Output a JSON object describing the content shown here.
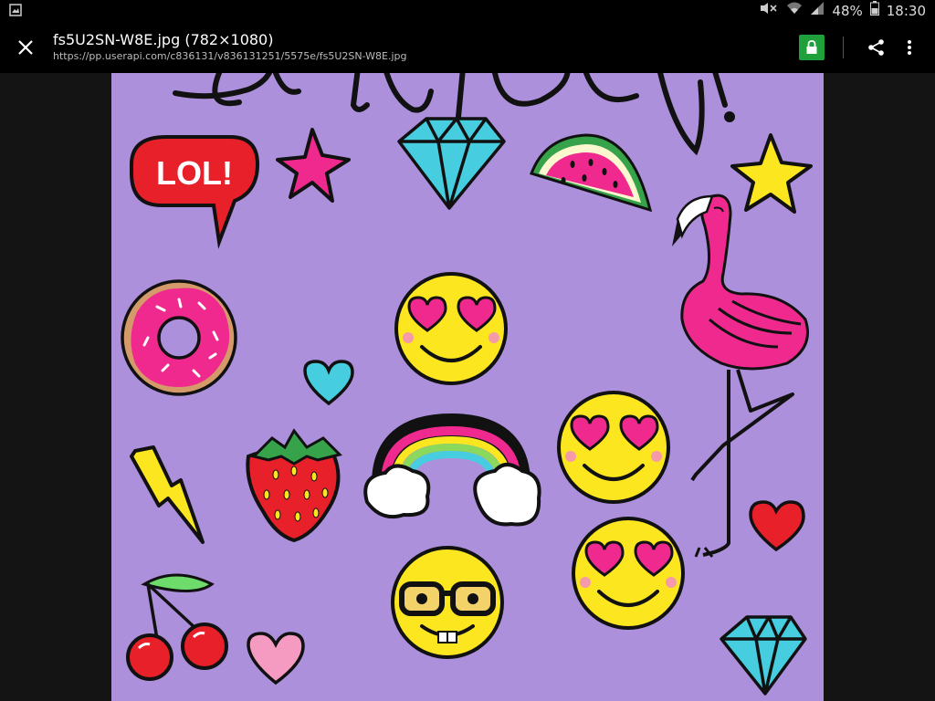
{
  "status_bar": {
    "battery": "48%",
    "time": "18:30",
    "icons": [
      "gallery-icon",
      "mute-icon",
      "wifi-icon",
      "signal-icon",
      "battery-icon"
    ]
  },
  "toolbar": {
    "title": "fs5U2SN-W8E.jpg (782×1080)",
    "url": "https://pp.userapi.com/c836131/v836131251/5575e/fs5U2SN-W8E.jpg",
    "icons": [
      "close-icon",
      "lock-icon",
      "share-icon",
      "more-vert-icon"
    ]
  },
  "image": {
    "speech_bubble_text": "LOL!",
    "background_color": "#ad90dc",
    "accent_colors": {
      "pink": "#f0298e",
      "yellow": "#fbe620",
      "cyan": "#46cde0",
      "red": "#e8202a",
      "green": "#36a24a"
    }
  },
  "colors": {
    "bar_bg": "#000000",
    "viewer_bg": "#141414",
    "lock_green": "#1fa03a"
  }
}
